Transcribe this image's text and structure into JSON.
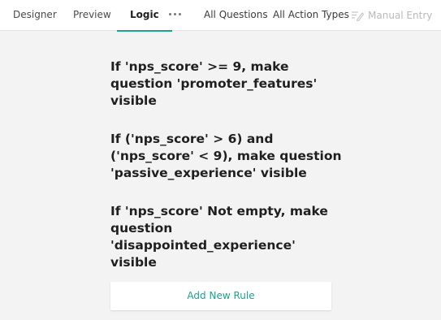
{
  "tabs": [
    {
      "label": "Designer"
    },
    {
      "label": "Preview"
    },
    {
      "label": "Logic",
      "active": true
    }
  ],
  "more_icon": "ellipsis-horizontal-icon",
  "filters": {
    "questions": "All Questions",
    "action_types": "All Action Types"
  },
  "manual_entry": {
    "label": "Manual Entry",
    "icon": "edit-note-icon",
    "disabled": true
  },
  "rules": [
    "If 'nps_score' >= 9, make question 'promoter_features' visible",
    "If ('nps_score' > 6) and ('nps_score' < 9), make question 'passive_experience' visible",
    "If 'nps_score' Not empty, make question 'disappointed_experience' visible"
  ],
  "add_rule_label": "Add New Rule",
  "colors": {
    "accent": "#1aa391",
    "background": "#f3f3f3",
    "disabled": "#b9b9b9"
  }
}
